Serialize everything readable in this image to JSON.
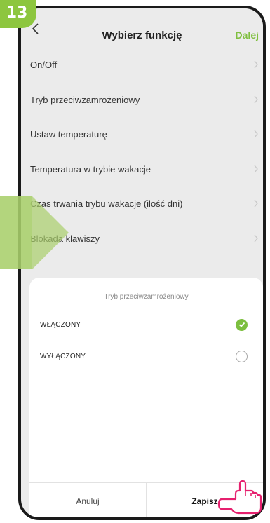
{
  "step_badge": "13",
  "header": {
    "back_icon": "chevron-left-icon",
    "title": "Wybierz funkcję",
    "next_label": "Dalej"
  },
  "function_list": [
    {
      "label": "On/Off"
    },
    {
      "label": "Tryb przeciwzamrożeniowy"
    },
    {
      "label": "Ustaw temperaturę"
    },
    {
      "label": "Temperatura w trybie wakacje"
    },
    {
      "label": "Czas trwania trybu wakacje (ilość dni)"
    },
    {
      "label": "Blokada klawiszy"
    }
  ],
  "sheet": {
    "title": "Tryb przeciwzamrożeniowy",
    "options": [
      {
        "label": "WŁĄCZONY",
        "selected": true
      },
      {
        "label": "WYŁĄCZONY",
        "selected": false
      }
    ],
    "cancel_label": "Anuluj",
    "save_label": "Zapisz"
  },
  "colors": {
    "accent_green": "#7cbf3f",
    "badge_green": "#8dc63f",
    "arrow_green": "#a9cf6b"
  }
}
